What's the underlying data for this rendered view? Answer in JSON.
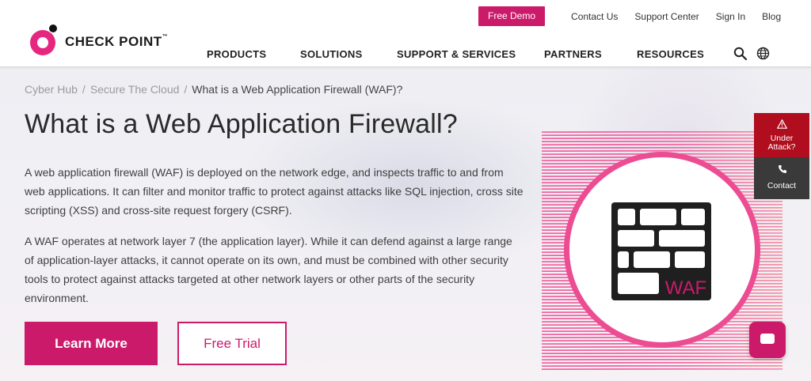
{
  "brand": {
    "name": "CHECK POINT",
    "tm": "™",
    "accent": "#cc1a6b",
    "alert": "#b00e1e"
  },
  "utility_nav": {
    "demo_label": "Free Demo",
    "links": [
      "Contact Us",
      "Support Center",
      "Sign In",
      "Blog"
    ]
  },
  "main_nav": {
    "items": [
      "PRODUCTS",
      "SOLUTIONS",
      "SUPPORT & SERVICES",
      "PARTNERS",
      "RESOURCES"
    ],
    "icons": [
      "search-icon",
      "globe-icon"
    ]
  },
  "breadcrumb": {
    "items": [
      "Cyber Hub",
      "Secure The Cloud",
      "What is a Web Application Firewall (WAF)?"
    ],
    "separator": "/"
  },
  "hero": {
    "title": "What is a Web Application Firewall?",
    "paragraphs": [
      "A web application firewall (WAF) is deployed on the network edge, and inspects traffic to and from web applications. It can filter and monitor traffic to protect against attacks like SQL injection, cross site scripting (XSS) and cross-site request forgery (CSRF).",
      "A WAF operates at network layer 7 (the application layer). While it can defend against a large range of application-layer attacks, it cannot operate on its own, and must be combined with other security tools to protect against attacks targeted at other network layers or other parts of the security environment."
    ],
    "learn_more_label": "Learn More",
    "free_trial_label": "Free Trial",
    "illustration_text": "WAF"
  },
  "side_widget": {
    "under_attack_line1": "Under",
    "under_attack_line2": "Attack?",
    "contact_label": "Contact"
  }
}
